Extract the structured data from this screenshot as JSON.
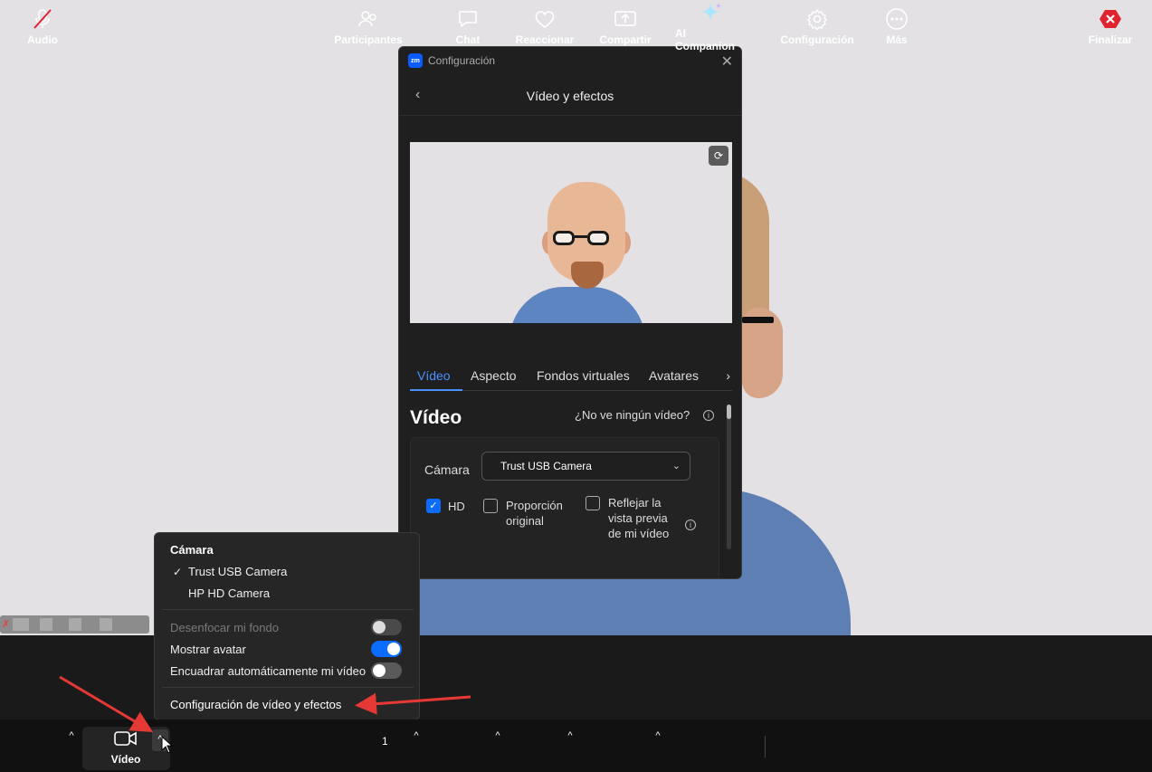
{
  "settings_window": {
    "title": "Configuración",
    "logo_text": "zm",
    "header_title": "Vídeo y efectos",
    "tabs": [
      {
        "label": "Vídeo",
        "active": true
      },
      {
        "label": "Aspecto",
        "active": false
      },
      {
        "label": "Fondos virtuales",
        "active": false
      },
      {
        "label": "Avatares",
        "active": false
      }
    ],
    "section_title": "Vídeo",
    "help_link": "¿No ve ningún vídeo?",
    "camera_label": "Cámara",
    "camera_selected": "Trust USB Camera",
    "options": {
      "hd": "HD",
      "original_ratio": "Proporción original",
      "mirror": "Reflejar la vista previa de mi vídeo"
    }
  },
  "camera_menu": {
    "title": "Cámara",
    "cameras": [
      {
        "label": "Trust USB Camera",
        "selected": true
      },
      {
        "label": "HP HD Camera",
        "selected": false
      }
    ],
    "toggles": [
      {
        "label": "Desenfocar mi fondo",
        "state": "disabled"
      },
      {
        "label": "Mostrar avatar",
        "state": "on"
      },
      {
        "label": "Encuadrar automáticamente mi vídeo",
        "state": "off"
      }
    ],
    "settings_link": "Configuración de vídeo y efectos"
  },
  "toolbar": {
    "audio": "Audio",
    "video": "Vídeo",
    "participants": "Participantes",
    "participants_count": "1",
    "chat": "Chat",
    "react": "Reaccionar",
    "share": "Compartir",
    "ai": "AI Companion",
    "settings": "Configuración",
    "more": "Más",
    "end": "Finalizar"
  },
  "colors": {
    "accent": "#0b6cff",
    "end_red": "#e0242f",
    "annotation_red": "#e53935"
  }
}
